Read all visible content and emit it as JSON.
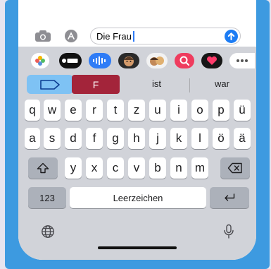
{
  "compose": {
    "text": "Die Frau"
  },
  "suggestions": {
    "active": "F",
    "s1": "ist",
    "s2": "war"
  },
  "keyboard": {
    "row1": [
      "q",
      "w",
      "e",
      "r",
      "t",
      "z",
      "u",
      "i",
      "o",
      "p",
      "ü"
    ],
    "row2": [
      "a",
      "s",
      "d",
      "f",
      "g",
      "h",
      "j",
      "k",
      "l",
      "ö",
      "ä"
    ],
    "row3": [
      "y",
      "x",
      "c",
      "v",
      "b",
      "n",
      "m"
    ],
    "numbers_label": "123",
    "space_label": "Leerzeichen"
  },
  "apps": [
    "photos-app",
    "apple-cash-app",
    "audio-message-app",
    "memoji-app",
    "memoji-stickers-app",
    "search-images-app",
    "digital-touch-app",
    "more-apps"
  ],
  "colors": {
    "frame": "#3d9ae0",
    "send": "#1c7cf4",
    "suggestion_active": "#a3243a",
    "chip": "#7ec2f4"
  }
}
